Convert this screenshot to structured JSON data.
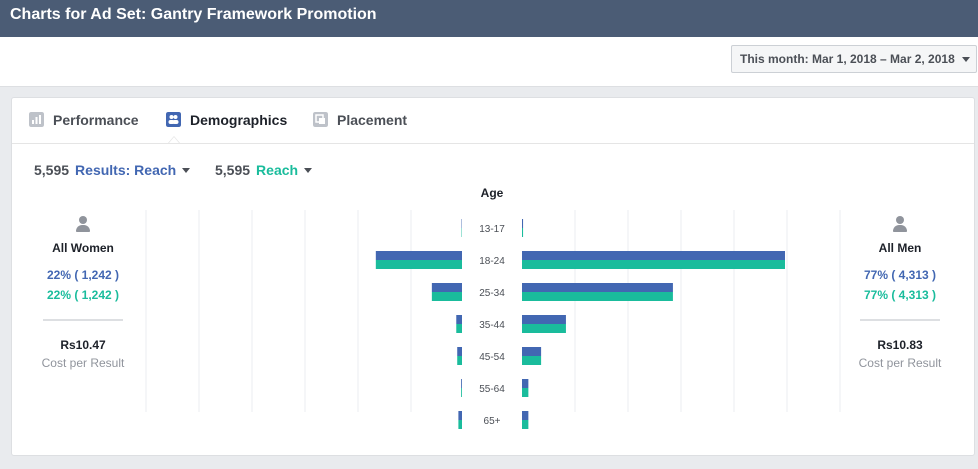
{
  "header": {
    "title": "Charts for Ad Set: Gantry Framework Promotion"
  },
  "date_range": {
    "label": "This month: Mar 1, 2018 – Mar 2, 2018"
  },
  "tabs": [
    {
      "label": "Performance",
      "icon": "bar-chart-icon",
      "active": false
    },
    {
      "label": "Demographics",
      "icon": "people-icon",
      "active": true
    },
    {
      "label": "Placement",
      "icon": "placement-icon",
      "active": false
    }
  ],
  "metrics": [
    {
      "value": "5,595",
      "label": "Results: Reach",
      "color": "#4267b2"
    },
    {
      "value": "5,595",
      "label": "Reach",
      "color": "#1abc9c"
    }
  ],
  "women": {
    "title": "All Women",
    "results_pct": "22% ( 1,242 )",
    "reach_pct": "22% ( 1,242 )",
    "cost": "Rs10.47",
    "cost_label": "Cost per Result"
  },
  "men": {
    "title": "All Men",
    "results_pct": "77% ( 4,313 )",
    "reach_pct": "77% ( 4,313 )",
    "cost": "Rs10.83",
    "cost_label": "Cost per Result"
  },
  "colors": {
    "results": "#4267b2",
    "reach": "#1abc9c",
    "header": "#4b5c75"
  },
  "chart_data": {
    "type": "bar",
    "orientation": "horizontal-butterfly",
    "title": "Age",
    "categories": [
      "13-17",
      "18-24",
      "25-34",
      "35-44",
      "45-54",
      "55-64",
      "65+"
    ],
    "women": {
      "results": [
        4,
        812,
        284,
        54,
        45,
        8,
        34
      ],
      "reach": [
        4,
        812,
        284,
        54,
        45,
        8,
        34
      ]
    },
    "men": {
      "results": [
        10,
        2478,
        1422,
        414,
        180,
        60,
        60
      ],
      "reach": [
        10,
        2478,
        1422,
        414,
        180,
        60,
        60
      ]
    },
    "scale_max": 2478,
    "grid": true
  }
}
